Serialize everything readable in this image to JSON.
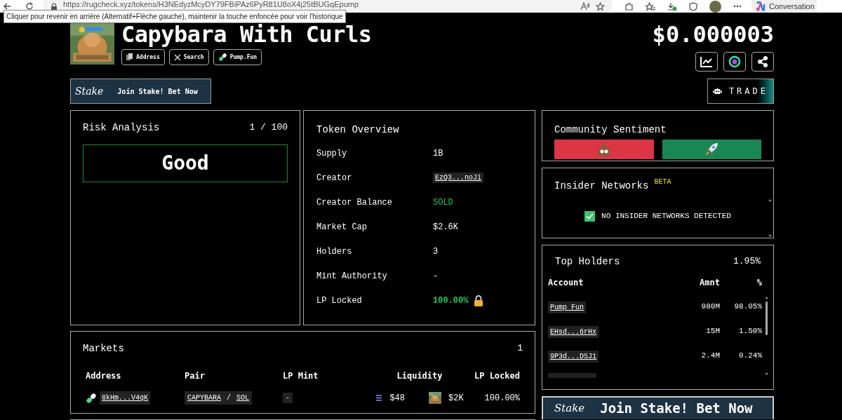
{
  "browser": {
    "url": "https://rugcheck.xyz/tokens/H3NEdyzMcyDY79FBiPAz6PyR81U8oX4j25tBUGqEpump",
    "tooltip": "Cliquer pour revenir en arrière (Alternatif+Flèche gauche), maintenir la touche enfoncée pour voir l'historique",
    "copilot_label": "Conversation"
  },
  "token": {
    "name": "Capybara With Curls",
    "price": "$0.000003",
    "links": [
      {
        "kind": "copy",
        "label": "Address"
      },
      {
        "kind": "x",
        "label": "Search"
      },
      {
        "kind": "pill",
        "label": "Pump.Fun"
      }
    ],
    "actions": [
      {
        "kind": "chart"
      },
      {
        "kind": "bubble"
      },
      {
        "kind": "share"
      }
    ],
    "trade_label": "TRADE"
  },
  "ad_top": {
    "brand": "Stake",
    "text": "Join Stake! Bet Now"
  },
  "risk_analysis": {
    "title": "Risk Analysis",
    "score": "1 / 100",
    "verdict": "Good"
  },
  "token_overview": {
    "title": "Token Overview",
    "rows": [
      {
        "label": "Supply",
        "value": "1B",
        "kind": "text"
      },
      {
        "label": "Creator",
        "value": "EzQ3...noJi",
        "kind": "link"
      },
      {
        "label": "Creator Balance",
        "value": "SOLD",
        "kind": "positive"
      },
      {
        "label": "Market Cap",
        "value": "$2.6K",
        "kind": "text"
      },
      {
        "label": "Holders",
        "value": "3",
        "kind": "text"
      },
      {
        "label": "Mint Authority",
        "value": "-",
        "kind": "text"
      },
      {
        "label": "LP Locked",
        "value": "100.00%",
        "kind": "locked"
      }
    ]
  },
  "community_sentiment": {
    "title": "Community Sentiment",
    "votes": [
      {
        "kind": "down"
      },
      {
        "kind": "up"
      }
    ]
  },
  "insider_networks": {
    "title": "Insider Networks",
    "badge": "BETA",
    "status": "NO INSIDER NETWORKS DETECTED",
    "checked": true
  },
  "top_holders": {
    "title": "Top Holders",
    "total": "1.95%",
    "columns": [
      "Account",
      "Amnt",
      "%"
    ],
    "rows": [
      {
        "account": "Pump Fun",
        "amount": "980M",
        "percent": "98.05%"
      },
      {
        "account": "EHsd...6rHx",
        "amount": "15M",
        "percent": "1.50%"
      },
      {
        "account": "9P3d...DSJ1",
        "amount": "2.4M",
        "percent": "0.24%"
      }
    ]
  },
  "ad_side": {
    "brand": "Stake",
    "text": "Join Stake! Bet Now"
  },
  "markets": {
    "title": "Markets",
    "count": "1",
    "columns": [
      "Address",
      "Pair",
      "LP Mint",
      "Liquidity",
      "LP Locked"
    ],
    "rows": [
      {
        "address": "8kHm...V4qK",
        "pair_base": "CAPYBARA",
        "pair_separator": "/",
        "pair_quote": "SOL",
        "lp_mint": "-",
        "liquidity_quote": "$48",
        "liquidity_base": "$2K",
        "lp_locked": "100.00%"
      }
    ]
  }
}
